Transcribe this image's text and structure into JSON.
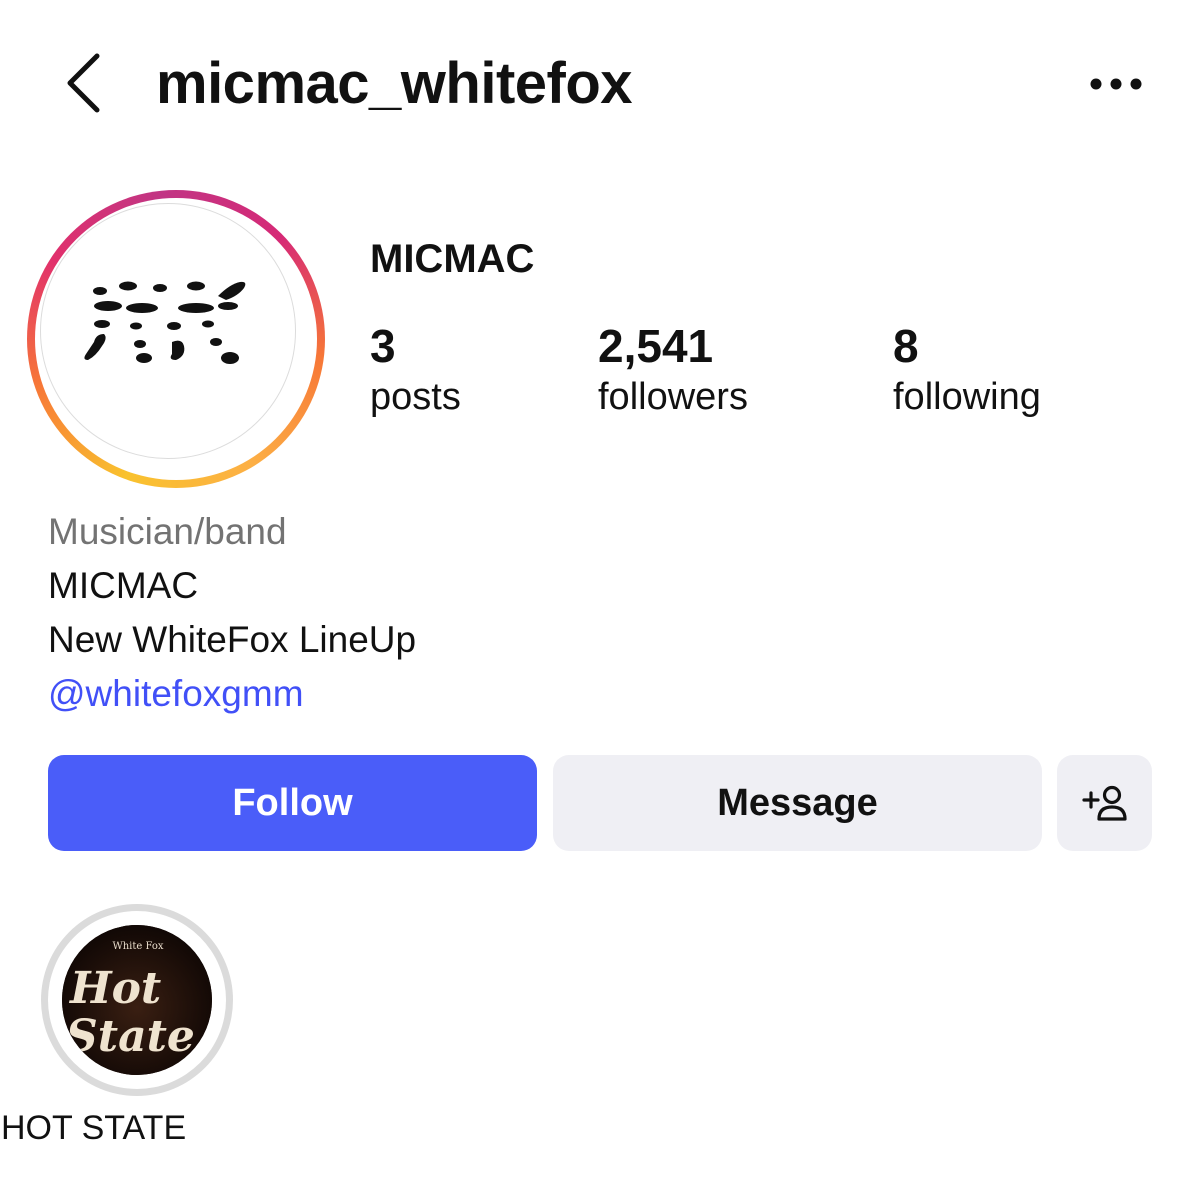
{
  "header": {
    "username": "micmac_whitefox",
    "back_icon": "chevron-left-icon",
    "more_icon": "more-horizontal-icon"
  },
  "profile": {
    "display_name": "MICMAC",
    "stats": {
      "posts": {
        "count": "3",
        "label": "posts"
      },
      "followers": {
        "count": "2,541",
        "label": "followers"
      },
      "following": {
        "count": "8",
        "label": "following"
      }
    },
    "bio": {
      "category": "Musician/band",
      "line1": "MICMAC",
      "line2": "New WhiteFox LineUp",
      "mention": "@whitefoxgmm"
    }
  },
  "actions": {
    "follow_label": "Follow",
    "message_label": "Message",
    "add_user_icon": "add-person-icon"
  },
  "highlights": [
    {
      "label": "HOT STATE",
      "cover_small_text": "White Fox",
      "cover_text_top": "Hot",
      "cover_text_bottom": "State"
    }
  ],
  "colors": {
    "follow_button": "#4a5df9",
    "link": "#4150f7",
    "secondary_button": "#efeff4",
    "category_text": "#737373"
  }
}
